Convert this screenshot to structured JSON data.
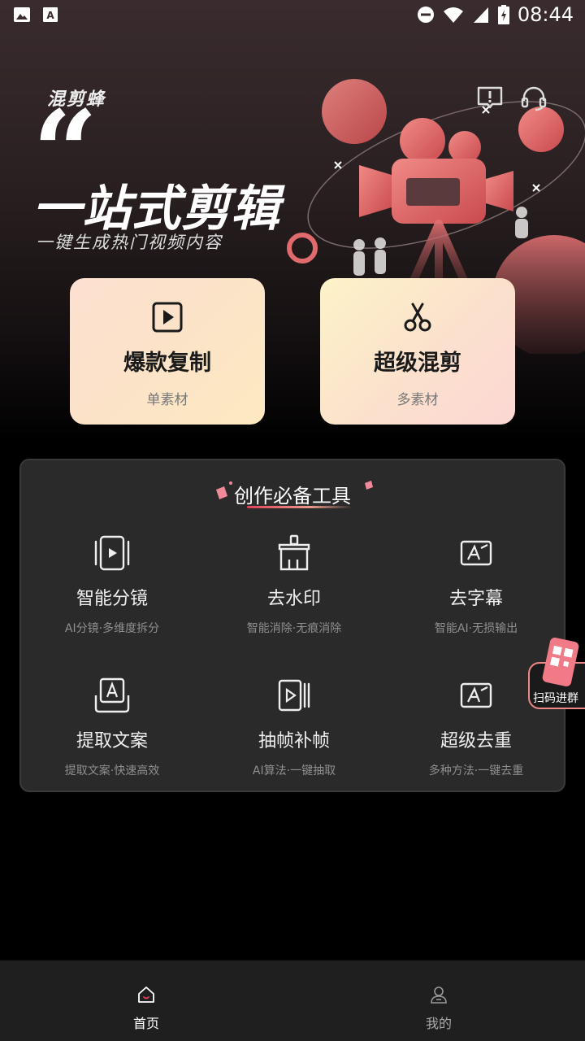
{
  "status_bar": {
    "time": "08:44"
  },
  "hero": {
    "brand": "混剪蜂",
    "quote_mark": "“",
    "headline": "一站式剪辑",
    "subline": "一键生成热门视频内容"
  },
  "cards": [
    {
      "title": "爆款复制",
      "subtitle": "单素材",
      "icon": "play-square-icon"
    },
    {
      "title": "超级混剪",
      "subtitle": "多素材",
      "icon": "scissors-icon"
    }
  ],
  "tools": {
    "title": "创作必备工具",
    "items": [
      {
        "name": "智能分镜",
        "desc": "AI分镜·多维度拆分",
        "icon": "storyboard-icon"
      },
      {
        "name": "去水印",
        "desc": "智能消除·无痕消除",
        "icon": "brush-icon"
      },
      {
        "name": "去字幕",
        "desc": "智能AI·无损输出",
        "icon": "subtitle-erase-icon"
      },
      {
        "name": "提取文案",
        "desc": "提取文案·快速高效",
        "icon": "text-extract-icon"
      },
      {
        "name": "抽帧补帧",
        "desc": "AI算法·一键抽取",
        "icon": "frames-icon"
      },
      {
        "name": "超级去重",
        "desc": "多种方法·一键去重",
        "icon": "dedupe-icon"
      }
    ]
  },
  "scan_group": {
    "label": "扫码进群"
  },
  "nav": {
    "home": "首页",
    "mine": "我的"
  },
  "colors": {
    "accent": "#e0405a",
    "card_bg": "#2a2a2a"
  }
}
